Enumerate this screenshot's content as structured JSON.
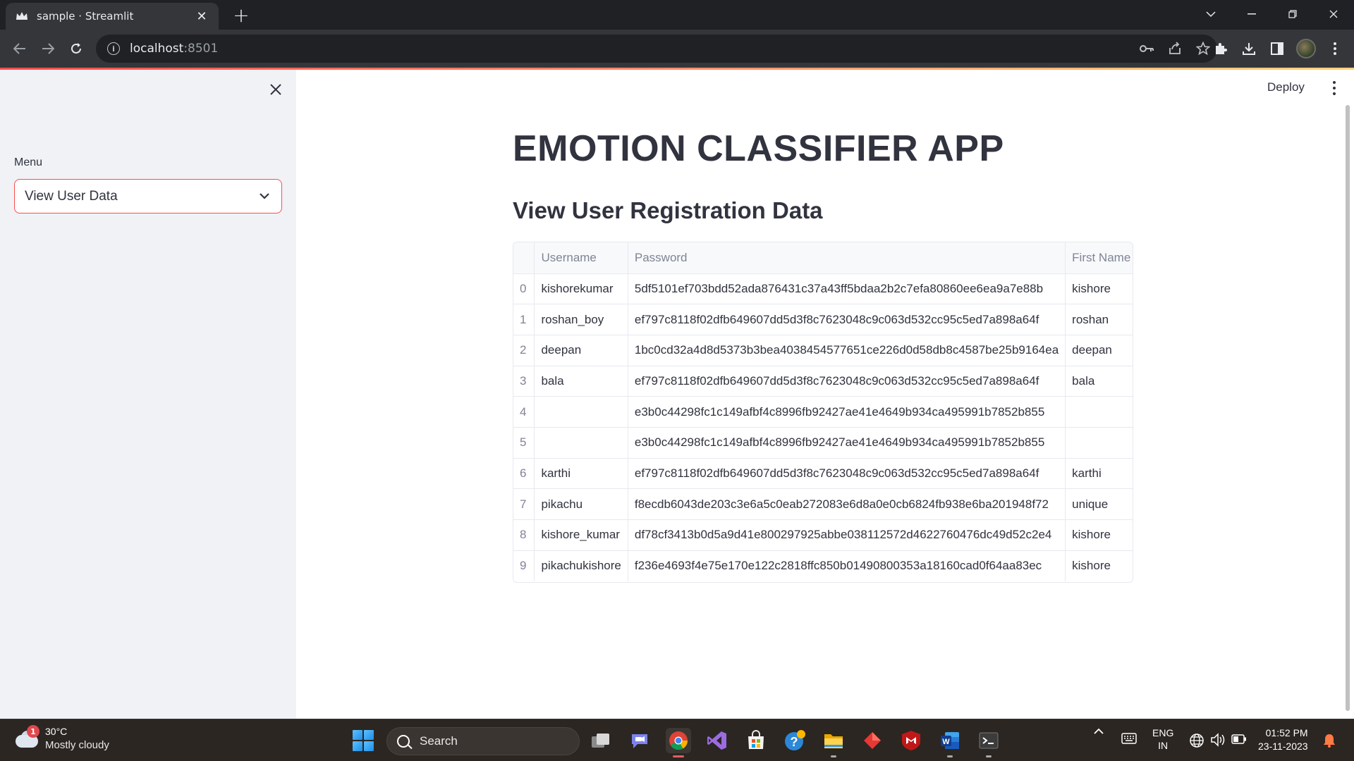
{
  "browser": {
    "tab_title": "sample · Streamlit",
    "url_host": "localhost",
    "url_port": ":8501"
  },
  "sidebar": {
    "menu_label": "Menu",
    "menu_selected": "View User Data"
  },
  "header": {
    "deploy_label": "Deploy"
  },
  "main": {
    "title": "EMOTION CLASSIFIER APP",
    "subtitle": "View User Registration Data"
  },
  "table": {
    "columns": [
      "Username",
      "Password",
      "First Name"
    ],
    "rows": [
      {
        "index": "0",
        "username": "kishorekumar",
        "password": "5df5101ef703bdd52ada876431c37a43ff5bdaa2b2c7efa80860ee6ea9a7e88b",
        "first_name": "kishore"
      },
      {
        "index": "1",
        "username": "roshan_boy",
        "password": "ef797c8118f02dfb649607dd5d3f8c7623048c9c063d532cc95c5ed7a898a64f",
        "first_name": "roshan"
      },
      {
        "index": "2",
        "username": "deepan",
        "password": "1bc0cd32a4d8d5373b3bea4038454577651ce226d0d58db8c4587be25b9164ea",
        "first_name": "deepan"
      },
      {
        "index": "3",
        "username": "bala",
        "password": "ef797c8118f02dfb649607dd5d3f8c7623048c9c063d532cc95c5ed7a898a64f",
        "first_name": "bala"
      },
      {
        "index": "4",
        "username": "",
        "password": "e3b0c44298fc1c149afbf4c8996fb92427ae41e4649b934ca495991b7852b855",
        "first_name": ""
      },
      {
        "index": "5",
        "username": "",
        "password": "e3b0c44298fc1c149afbf4c8996fb92427ae41e4649b934ca495991b7852b855",
        "first_name": ""
      },
      {
        "index": "6",
        "username": "karthi",
        "password": "ef797c8118f02dfb649607dd5d3f8c7623048c9c063d532cc95c5ed7a898a64f",
        "first_name": "karthi"
      },
      {
        "index": "7",
        "username": "pikachu",
        "password": "f8ecdb6043de203c3e6a5c0eab272083e6d8a0e0cb6824fb938e6ba201948f72",
        "first_name": "unique"
      },
      {
        "index": "8",
        "username": "kishore_kumar",
        "password": "df78cf3413b0d5a9d41e800297925abbe038112572d4622760476dc49d52c2e4",
        "first_name": "kishore"
      },
      {
        "index": "9",
        "username": "pikachukishore",
        "password": "f236e4693f4e75e170e122c2818ffc850b01490800353a18160cad0f64aa83ec",
        "first_name": "kishore"
      }
    ]
  },
  "taskbar": {
    "weather_temp": "30°C",
    "weather_desc": "Mostly cloudy",
    "weather_badge": "1",
    "search_label": "Search",
    "lang_line1": "ENG",
    "lang_line2": "IN",
    "time": "01:52 PM",
    "date": "23-11-2023"
  },
  "colors": {
    "streamlit_accent": "#ff4b4b",
    "sidebar_bg": "#f0f2f6",
    "text": "#31333f"
  }
}
